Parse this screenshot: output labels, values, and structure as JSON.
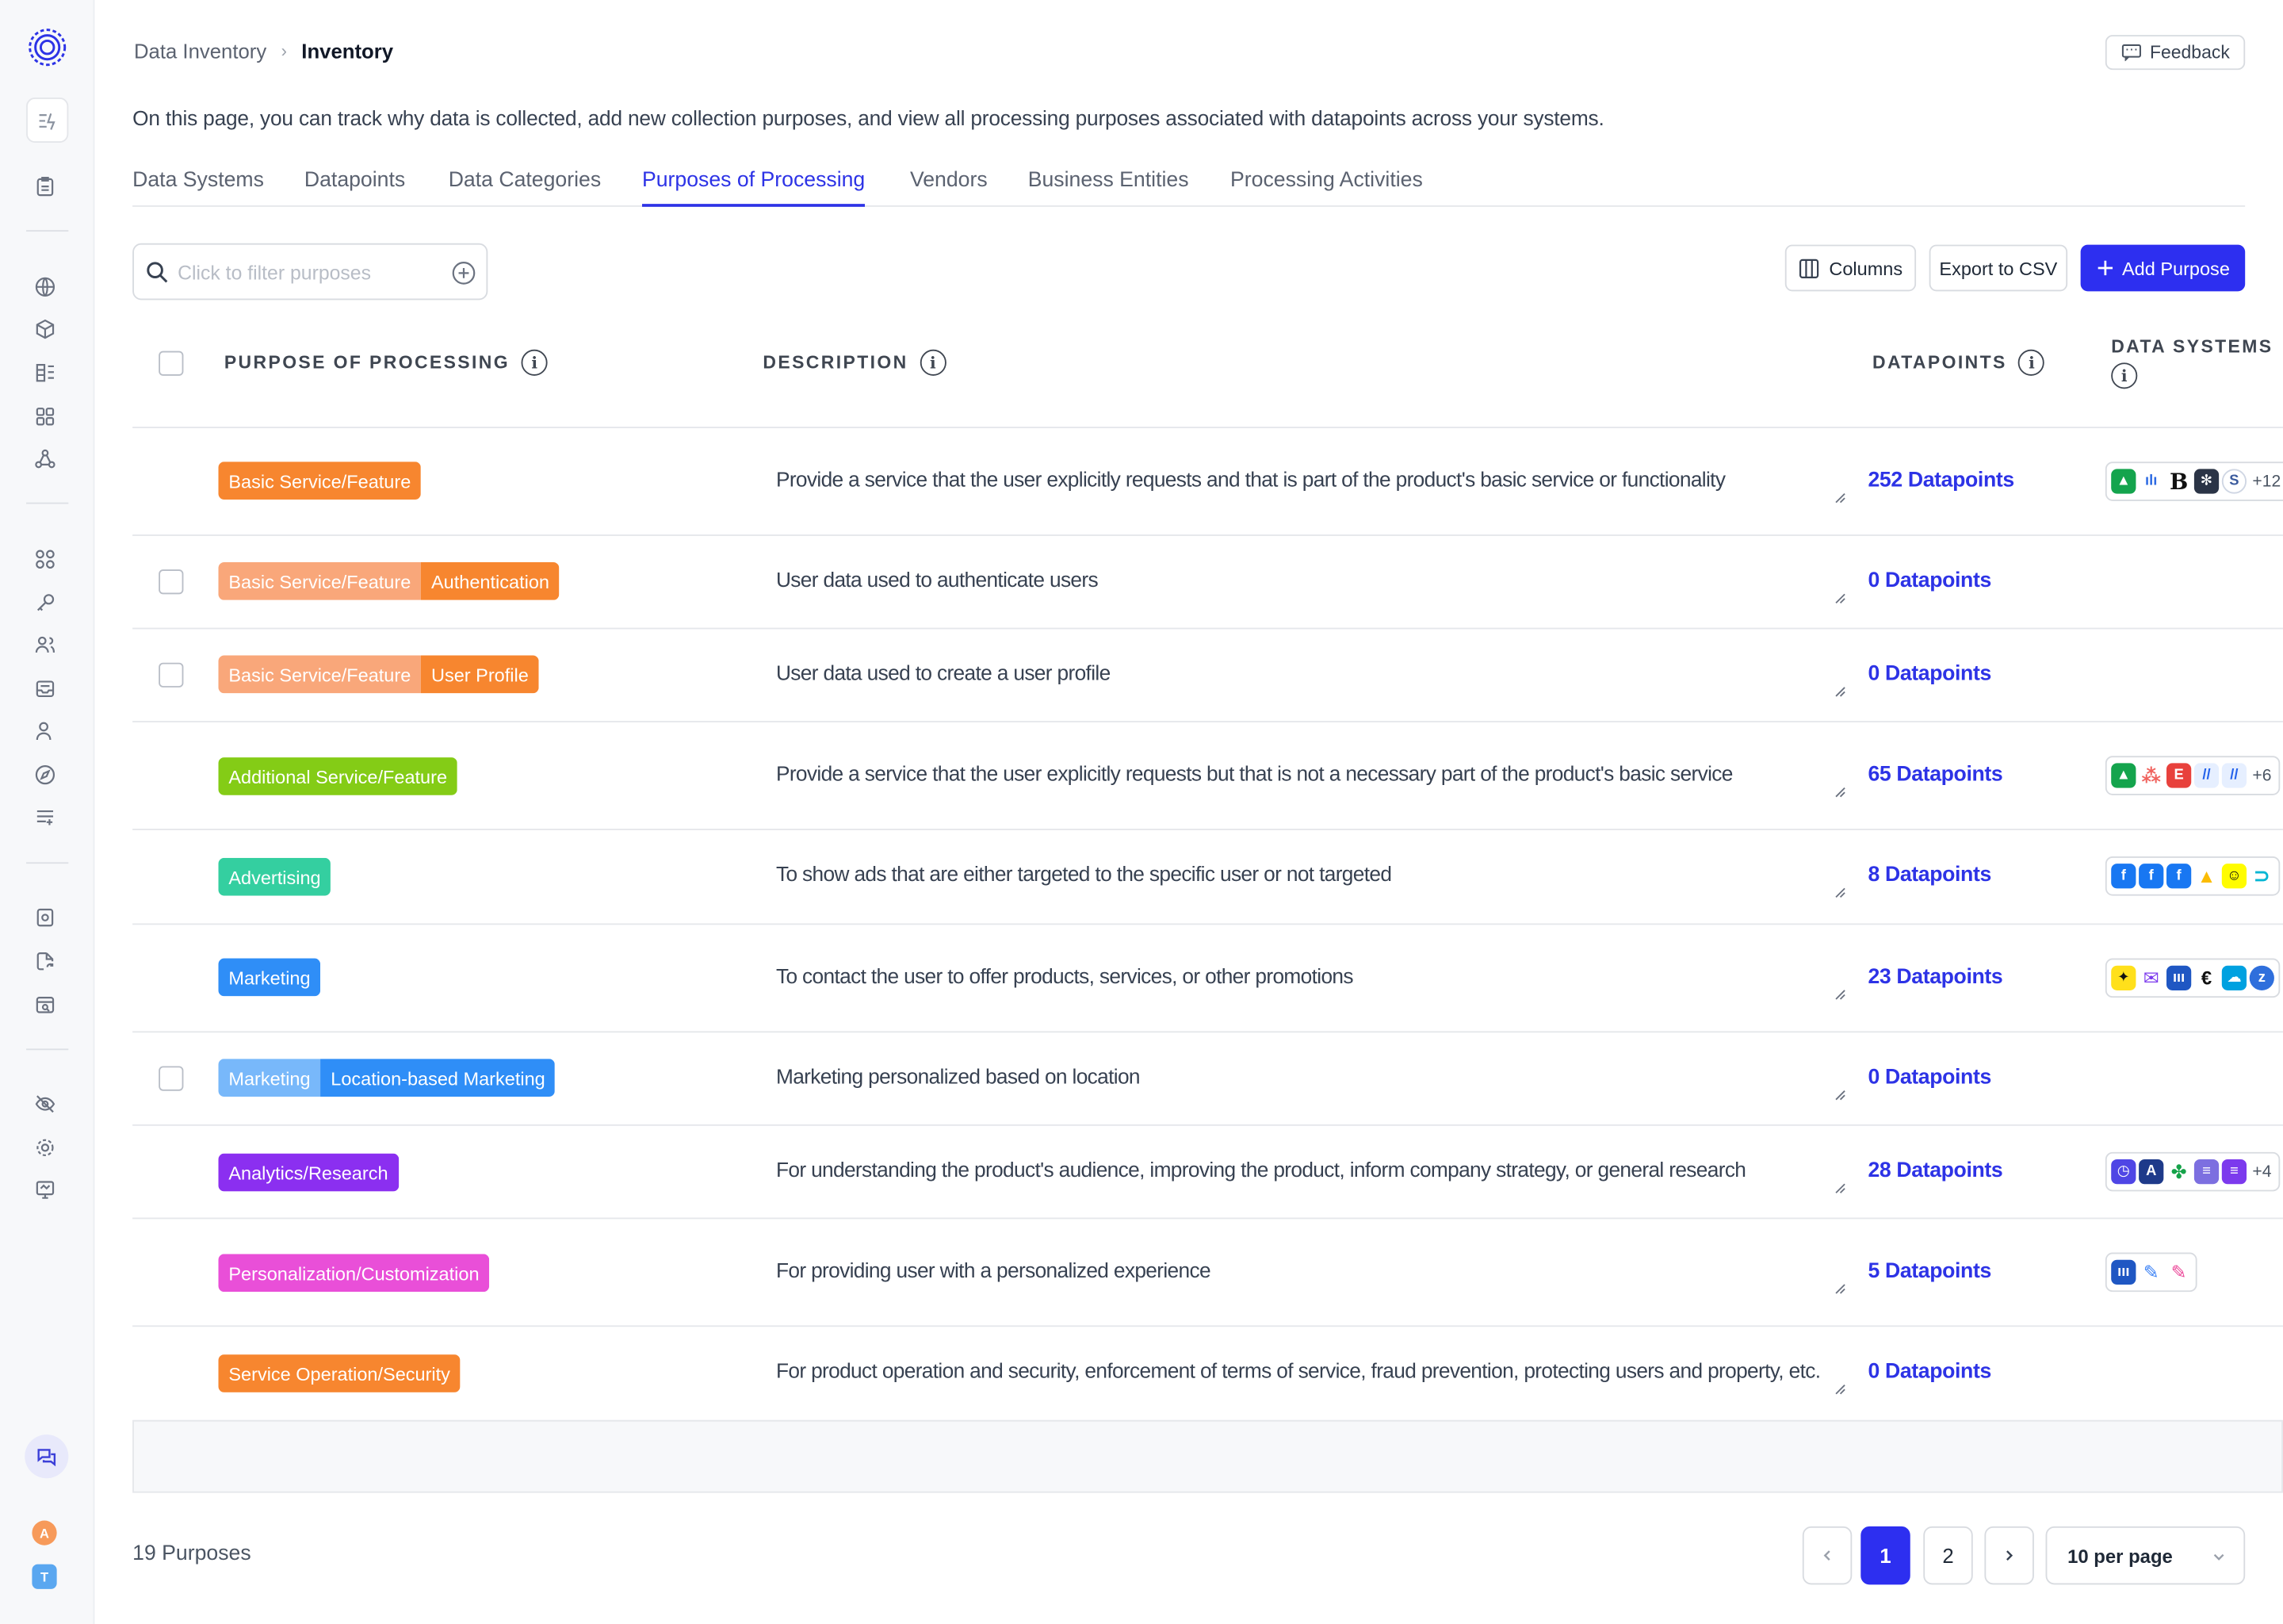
{
  "breadcrumb": {
    "root": "Data Inventory",
    "separator": "›",
    "current": "Inventory"
  },
  "feedback_label": "Feedback",
  "intro": "On this page, you can track why data is collected, add new collection purposes, and view all processing purposes associated with datapoints across your systems.",
  "tabs": [
    "Data Systems",
    "Datapoints",
    "Data Categories",
    "Purposes of Processing",
    "Vendors",
    "Business Entities",
    "Processing Activities"
  ],
  "active_tab": "Purposes of Processing",
  "search": {
    "placeholder": "Click to filter purposes"
  },
  "toolbar": {
    "columns_label": "Columns",
    "export_label": "Export to CSV",
    "add_label": "Add Purpose"
  },
  "table": {
    "headers": {
      "purpose": "PURPOSE OF PROCESSING",
      "description": "DESCRIPTION",
      "datapoints": "DATAPOINTS",
      "systems": "DATA SYSTEMS"
    },
    "rows": [
      {
        "tags": [
          "Basic Service/Feature"
        ],
        "description": "Provide a service that the user explicitly requests and that is part of the product's basic service or functionality",
        "datapoints": "252 Datapoints",
        "more": "+12"
      },
      {
        "tags": [
          "Basic Service/Feature",
          "Authentication"
        ],
        "description": "User data used to authenticate users",
        "datapoints": "0 Datapoints"
      },
      {
        "tags": [
          "Basic Service/Feature",
          "User Profile"
        ],
        "description": "User data used to create a user profile",
        "datapoints": "0 Datapoints"
      },
      {
        "tags": [
          "Additional Service/Feature"
        ],
        "description": "Provide a service that the user explicitly requests but that is not a necessary part of the product's basic service",
        "datapoints": "65 Datapoints",
        "more": "+6"
      },
      {
        "tags": [
          "Advertising"
        ],
        "description": "To show ads that are either targeted to the specific user or not targeted",
        "datapoints": "8 Datapoints"
      },
      {
        "tags": [
          "Marketing"
        ],
        "description": "To contact the user to offer products, services, or other promotions",
        "datapoints": "23 Datapoints"
      },
      {
        "tags": [
          "Marketing",
          "Location-based Marketing"
        ],
        "description": "Marketing personalized based on location",
        "datapoints": "0 Datapoints"
      },
      {
        "tags": [
          "Analytics/Research"
        ],
        "description": "For understanding the product's audience, improving the product, inform company strategy, or general research",
        "datapoints": "28 Datapoints",
        "more": "+4"
      },
      {
        "tags": [
          "Personalization/Customization"
        ],
        "description": "For providing user with a personalized experience",
        "datapoints": "5 Datapoints"
      },
      {
        "tags": [
          "Service Operation/Security"
        ],
        "description": "For product operation and security, enforcement of terms of service, fraud prevention, protecting users and property, etc.",
        "datapoints": "0 Datapoints"
      }
    ]
  },
  "footer": {
    "count": "19 Purposes",
    "pages": [
      "1",
      "2"
    ],
    "current_page": "1",
    "per_page": "10 per page"
  },
  "avatars": [
    "A",
    "T"
  ],
  "colors": {
    "accent": "#2d2ff0",
    "orange": "#f7862f",
    "orange_light": "#f9a77a",
    "green": "#84cc16",
    "teal": "#34cfa0",
    "blue": "#2f8ef7",
    "blue_light": "#78b8fa",
    "purple": "#8b2ff0",
    "pink": "#e94fd8"
  }
}
